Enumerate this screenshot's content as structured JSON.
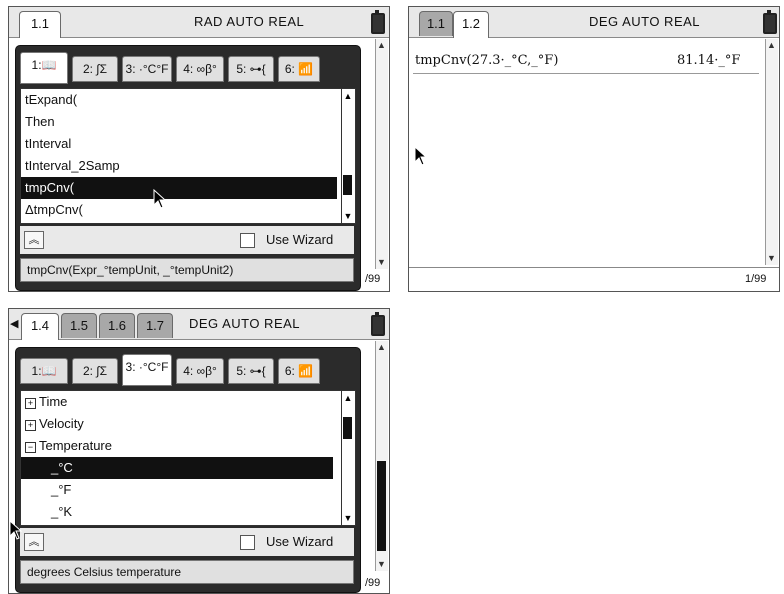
{
  "screen1": {
    "tabs": [
      "1.1"
    ],
    "status": "RAD AUTO REAL",
    "catalog_tabs": [
      "1:📖",
      "2: ∫Σ",
      "3: ·°C°F",
      "4: ∞β°",
      "5: ⊶{",
      "6: 📶"
    ],
    "items": [
      "tExpand(",
      "Then",
      "tInterval",
      "tInterval_2Samp",
      "tmpCnv(",
      "ΔtmpCnv("
    ],
    "selected_index": 4,
    "wizard_label": "Use Wizard",
    "help": "tmpCnv(Expr_°tempUnit, _°tempUnit2)",
    "page": "/99"
  },
  "screen2": {
    "tabs": [
      "1.1",
      "1.2"
    ],
    "status": "DEG AUTO REAL",
    "expr": "tmpCnv(27.3·_°C,_°F)",
    "result": "81.14·_°F",
    "page": "1/99"
  },
  "screen3": {
    "tabs": [
      "1.4",
      "1.5",
      "1.6",
      "1.7"
    ],
    "status": "DEG AUTO REAL",
    "catalog_tabs": [
      "1:📖",
      "2: ∫Σ",
      "3: ·°C°F",
      "4: ∞β°",
      "5: ⊶{",
      "6: 📶"
    ],
    "items": [
      "Time",
      "Velocity",
      "Temperature",
      "_°C",
      "_°F",
      "_°K"
    ],
    "item_markers": [
      "+",
      "+",
      "−",
      "",
      "",
      ""
    ],
    "selected_index": 3,
    "wizard_label": "Use Wizard",
    "help": "degrees Celsius temperature",
    "page": "/99"
  }
}
